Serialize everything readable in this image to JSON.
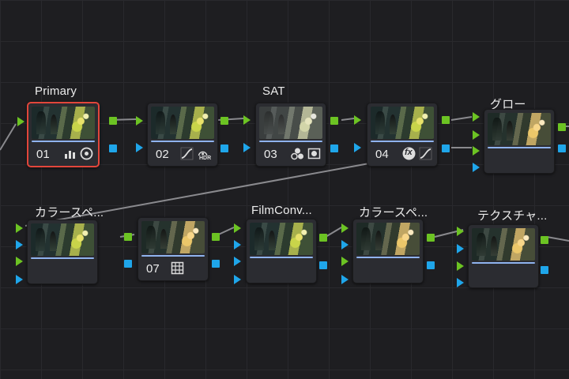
{
  "colors": {
    "canvas_bg": "#1e1e21",
    "node_bg": "#2b2c31",
    "selection_border": "#e2463b",
    "rgb_port": "#6cc323",
    "alpha_port": "#1fa6ea",
    "node_bar": "#8fb3ee"
  },
  "nodes": {
    "n01": {
      "label": "Primary",
      "number": "01",
      "icons": [
        "histogram-bars-icon",
        "circle-target-icon"
      ],
      "selected": true
    },
    "n02": {
      "label": "",
      "number": "02",
      "icons": [
        "curves-icon",
        "hdr-wheel-icon"
      ],
      "hdr_text": "HDR"
    },
    "n03": {
      "label": "SAT",
      "number": "03",
      "icons": [
        "color-circles-icon",
        "key-window-icon"
      ]
    },
    "n04": {
      "label": "",
      "number": "04",
      "icons": [
        "fx-icon",
        "curves-icon"
      ],
      "fx_text": "fx"
    },
    "n05": {
      "label": "グロー",
      "number": ""
    },
    "n06": {
      "label": "カラースペ...",
      "number": ""
    },
    "n07": {
      "label": "",
      "number": "07",
      "icons": [
        "grid-icon"
      ]
    },
    "n08": {
      "label": "FilmConv...",
      "number": ""
    },
    "n09": {
      "label": "カラースペ...",
      "number": ""
    },
    "n10": {
      "label": "テクスチャ...",
      "number": ""
    }
  }
}
